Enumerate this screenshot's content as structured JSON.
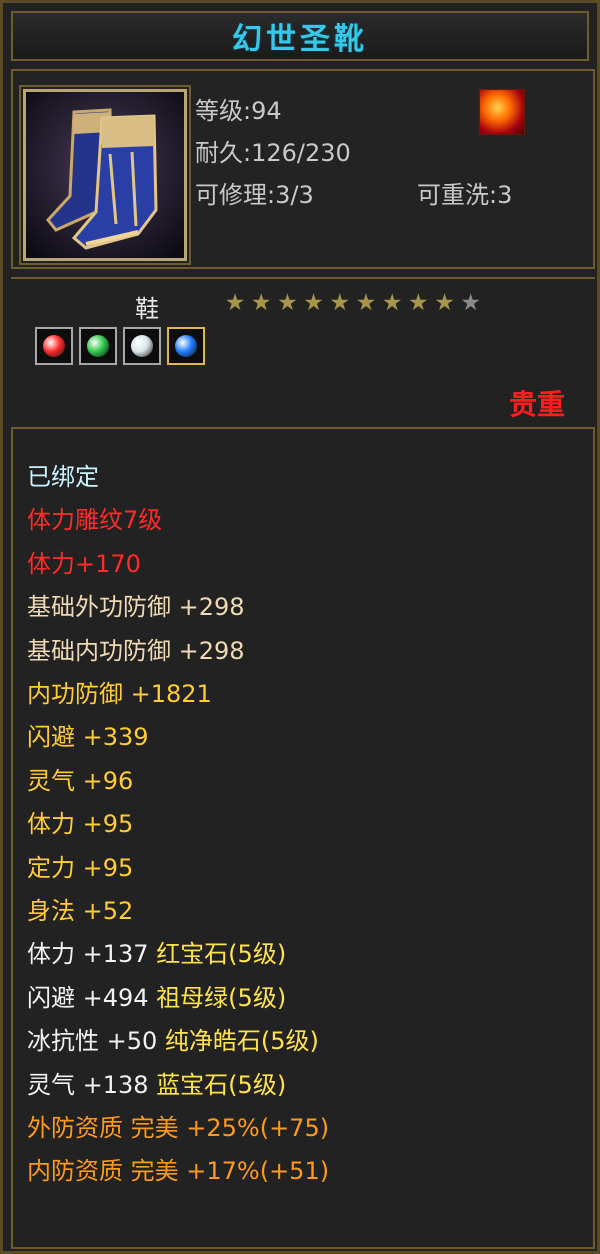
{
  "item": {
    "name": "幻世圣靴",
    "icon": "blue-gold-boots-icon",
    "school_icon": "flame-emblem-icon",
    "level": "等级:94",
    "durability": "耐久:126/230",
    "repair": "可修理:3/3",
    "rewash": "可重洗:3",
    "slot": "鞋",
    "stars": {
      "filled": 9,
      "total": 10
    },
    "gems": [
      {
        "icon": "red-gem-icon",
        "color": "#ff2a2a"
      },
      {
        "icon": "green-gem-icon",
        "color": "#2ec94a"
      },
      {
        "icon": "white-gem-icon",
        "color": "#d8e4e8"
      },
      {
        "icon": "blue-gem-icon",
        "color": "#1f7dff"
      }
    ],
    "rarity": "贵重"
  },
  "attributes": [
    {
      "parts": [
        {
          "text": "已绑定",
          "color": "#c9f3ff"
        }
      ]
    },
    {
      "parts": [
        {
          "text": "体力雕纹7级",
          "color": "#ff2a2a"
        }
      ]
    },
    {
      "parts": [
        {
          "text": "体力+170",
          "color": "#ff2a2a"
        }
      ]
    },
    {
      "parts": [
        {
          "text": "基础外功防御 +298",
          "color": "#f0d9b5"
        }
      ]
    },
    {
      "parts": [
        {
          "text": "基础内功防御 +298",
          "color": "#f0d9b5"
        }
      ]
    },
    {
      "parts": [
        {
          "text": "内功防御 +1821",
          "color": "#ffcc33"
        }
      ]
    },
    {
      "parts": [
        {
          "text": "闪避 +339",
          "color": "#ffcc33"
        }
      ]
    },
    {
      "parts": [
        {
          "text": "灵气 +96",
          "color": "#ffcc33"
        }
      ]
    },
    {
      "parts": [
        {
          "text": "体力 +95",
          "color": "#ffcc33"
        }
      ]
    },
    {
      "parts": [
        {
          "text": "定力 +95",
          "color": "#ffcc33"
        }
      ]
    },
    {
      "parts": [
        {
          "text": "身法 +52",
          "color": "#ffcc33"
        }
      ]
    },
    {
      "parts": [
        {
          "text": "体力 +137 ",
          "color": "#f2f2f2"
        },
        {
          "text": "红宝石(5级)",
          "color": "#ffe34d"
        }
      ]
    },
    {
      "parts": [
        {
          "text": "闪避 +494 ",
          "color": "#f2f2f2"
        },
        {
          "text": "祖母绿(5级)",
          "color": "#ffe34d"
        }
      ]
    },
    {
      "parts": [
        {
          "text": "冰抗性 +50 ",
          "color": "#f2f2f2"
        },
        {
          "text": "纯净皓石(5级)",
          "color": "#ffe34d"
        }
      ]
    },
    {
      "parts": [
        {
          "text": "灵气 +138 ",
          "color": "#f2f2f2"
        },
        {
          "text": "蓝宝石(5级)",
          "color": "#ffe34d"
        }
      ]
    },
    {
      "parts": [
        {
          "text": "外防资质 完美 +25%(+75)",
          "color": "#ff9a1a"
        }
      ]
    },
    {
      "parts": [
        {
          "text": "内防资质 完美 +17%(+51)",
          "color": "#ff9a1a"
        }
      ]
    }
  ]
}
